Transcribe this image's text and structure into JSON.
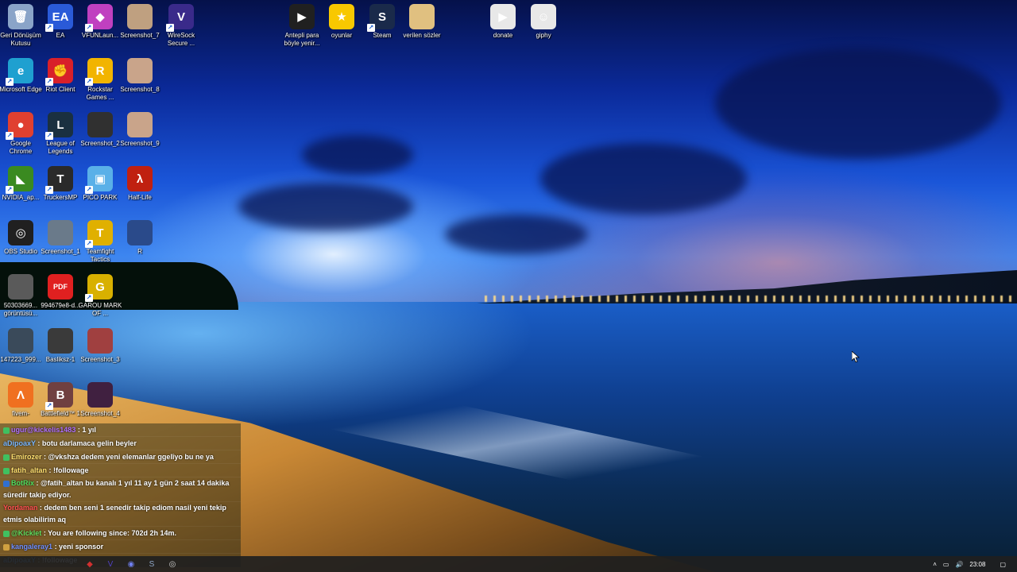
{
  "desktop": {
    "icons": [
      {
        "label": "Geri Dönüşüm Kutusu",
        "icon": "recycle-bin-icon",
        "color": "#8aa4c8",
        "glyph": "🗑",
        "shortcut": false
      },
      {
        "label": "EA",
        "icon": "ea-icon",
        "color": "#2a5ad8",
        "glyph": "EA",
        "shortcut": true
      },
      {
        "label": "VFUNLaun...",
        "icon": "vfun-launcher-icon",
        "color": "#c040c0",
        "glyph": "◆",
        "shortcut": true
      },
      {
        "label": "Screenshot_7",
        "icon": "screenshot-thumbnail-icon",
        "color": "#bfa080",
        "glyph": "",
        "shortcut": false
      },
      {
        "label": "WireSock Secure ...",
        "icon": "wiresock-icon",
        "color": "#3a2a8a",
        "glyph": "V",
        "shortcut": true
      },
      {
        "label": "Microsoft Edge",
        "icon": "edge-icon",
        "color": "#1fa0d0",
        "glyph": "e",
        "shortcut": true
      },
      {
        "label": "Riot Client",
        "icon": "riot-client-icon",
        "color": "#d8202a",
        "glyph": "✊",
        "shortcut": true
      },
      {
        "label": "Rockstar Games ...",
        "icon": "rockstar-icon",
        "color": "#f2b400",
        "glyph": "R",
        "shortcut": true
      },
      {
        "label": "Screenshot_8",
        "icon": "screenshot-thumbnail-icon",
        "color": "#c9a48a",
        "glyph": "",
        "shortcut": false
      },
      {
        "label": "Google Chrome",
        "icon": "chrome-icon",
        "color": "#e04030",
        "glyph": "●",
        "shortcut": true
      },
      {
        "label": "League of Legends",
        "icon": "league-of-legends-icon",
        "color": "#1a3040",
        "glyph": "L",
        "shortcut": true
      },
      {
        "label": "Screenshot_2",
        "icon": "screenshot-thumbnail-icon",
        "color": "#303030",
        "glyph": "",
        "shortcut": false
      },
      {
        "label": "Screenshot_9",
        "icon": "screenshot-thumbnail-icon",
        "color": "#c9a48a",
        "glyph": "",
        "shortcut": false
      },
      {
        "label": "NVIDIA_ap...",
        "icon": "nvidia-icon",
        "color": "#3a8a20",
        "glyph": "◣",
        "shortcut": true
      },
      {
        "label": "TruckersMP",
        "icon": "truckersmp-icon",
        "color": "#2a2a2a",
        "glyph": "T",
        "shortcut": true
      },
      {
        "label": "PICO PARK",
        "icon": "pico-park-icon",
        "color": "#5ab0e8",
        "glyph": "▣",
        "shortcut": true
      },
      {
        "label": "Half-Life",
        "icon": "half-life-icon",
        "color": "#c02010",
        "glyph": "λ",
        "shortcut": false
      },
      {
        "label": "OBS Studio",
        "icon": "obs-icon",
        "color": "#202020",
        "glyph": "◎",
        "shortcut": false
      },
      {
        "label": "Screenshot_1",
        "icon": "screenshot-thumbnail-icon",
        "color": "#6a7a8a",
        "glyph": "",
        "shortcut": false
      },
      {
        "label": "Teamfight Tactics",
        "icon": "teamfight-tactics-icon",
        "color": "#e0b000",
        "glyph": "T",
        "shortcut": true
      },
      {
        "label": "R",
        "icon": "image-file-icon",
        "color": "#2a4a8a",
        "glyph": "",
        "shortcut": false
      },
      {
        "label": "50303669... görüntüsü...",
        "icon": "screenshot-thumbnail-icon",
        "color": "#5a5a5a",
        "glyph": "",
        "shortcut": false
      },
      {
        "label": "994679e8-d...",
        "icon": "pdf-icon",
        "color": "#e02020",
        "glyph": "PDF",
        "shortcut": false
      },
      {
        "label": "GAROU MARK OF ...",
        "icon": "garou-icon",
        "color": "#d8b000",
        "glyph": "G",
        "shortcut": true
      },
      {
        "label": "147223_999...",
        "icon": "screenshot-thumbnail-icon",
        "color": "#3a4a5a",
        "glyph": "",
        "shortcut": false
      },
      {
        "label": "Basliksz-1",
        "icon": "image-file-icon",
        "color": "#3a3a3a",
        "glyph": "",
        "shortcut": false
      },
      {
        "label": "Screenshot_3",
        "icon": "screenshot-thumbnail-icon",
        "color": "#a04040",
        "glyph": "",
        "shortcut": false
      },
      {
        "label": "fivem-",
        "icon": "fivem-icon",
        "color": "#f07020",
        "glyph": "Λ",
        "shortcut": false
      },
      {
        "label": "Battlefield™ 1",
        "icon": "battlefield-icon",
        "color": "#704040",
        "glyph": "B",
        "shortcut": true
      },
      {
        "label": "Screenshot_4",
        "icon": "screenshot-thumbnail-icon",
        "color": "#402040",
        "glyph": "",
        "shortcut": false
      },
      {
        "label": "Antepli para böyle yenir...",
        "icon": "video-file-icon",
        "color": "#202020",
        "glyph": "▶",
        "shortcut": false
      },
      {
        "label": "oyunlar",
        "icon": "star-folder-icon",
        "color": "#f8c800",
        "glyph": "★",
        "shortcut": false
      },
      {
        "label": "Steam",
        "icon": "steam-icon",
        "color": "#1a2a4a",
        "glyph": "S",
        "shortcut": true
      },
      {
        "label": "verilen sözler",
        "icon": "folder-icon",
        "color": "#e0c080",
        "glyph": "",
        "shortcut": false
      },
      {
        "label": "donate",
        "icon": "media-file-icon",
        "color": "#e8e8e8",
        "glyph": "▶",
        "shortcut": false
      },
      {
        "label": "giphy",
        "icon": "gif-file-icon",
        "color": "#e8e8e8",
        "glyph": "☺",
        "shortcut": false
      }
    ]
  },
  "chat": {
    "lines": [
      {
        "user": "ugur@kickelis1483",
        "user_color": "#b070ff",
        "text": ": 1 yıl",
        "badge_color": "#40c060"
      },
      {
        "user": "aDipoaxY",
        "user_color": "#7ab8ff",
        "text": ": botu darlamaca gelin beyler",
        "badge_color": ""
      },
      {
        "user": "Emirozer",
        "user_color": "#ffe070",
        "text": ": @vkshza dedem yeni elemanlar ggelîyo bu ne ya",
        "badge_color": "#40c060"
      },
      {
        "user": "fatih_altan",
        "user_color": "#ffe070",
        "text": ": !followage",
        "badge_color": "#40c060"
      },
      {
        "user": "BotRix",
        "user_color": "#50e060",
        "text": ": @fatih_altan bu kanalı 1 yıl 11 ay 1 gün 2 saat 14 dakika süredir takip ediyor.",
        "badge_color": "#3070d0"
      },
      {
        "user": "Yordaman",
        "user_color": "#ff5050",
        "text": ": dedem ben seni 1 senedir takip ediom nasil yeni tekip etmis olabilirim aq",
        "badge_color": ""
      },
      {
        "user": "@Kicklet",
        "user_color": "#60e060",
        "text": ": You are following since: 702d 2h 14m.",
        "badge_color": "#40c060"
      },
      {
        "user": "kangaleray1",
        "user_color": "#7090ff",
        "text": ": yeni sponsor",
        "badge_color": "#d0a040"
      },
      {
        "user": "aDipoaxY",
        "user_color": "#7ab8ff",
        "text": ": !followage",
        "badge_color": ""
      }
    ]
  },
  "taskbar": {
    "apps": [
      {
        "name": "taskbar-app-1",
        "icon": "red-app-icon",
        "glyph": "◆",
        "color": "#d03030"
      },
      {
        "name": "taskbar-app-2",
        "icon": "vpn-icon",
        "glyph": "V",
        "color": "#5040c0"
      },
      {
        "name": "taskbar-app-3",
        "icon": "discord-icon",
        "glyph": "◉",
        "color": "#7080f0"
      },
      {
        "name": "taskbar-app-4",
        "icon": "steam-icon",
        "glyph": "S",
        "color": "#90a8c8"
      },
      {
        "name": "taskbar-app-5",
        "icon": "obs-icon",
        "glyph": "◎",
        "color": "#d0d0d0"
      }
    ],
    "time": "23:08"
  }
}
